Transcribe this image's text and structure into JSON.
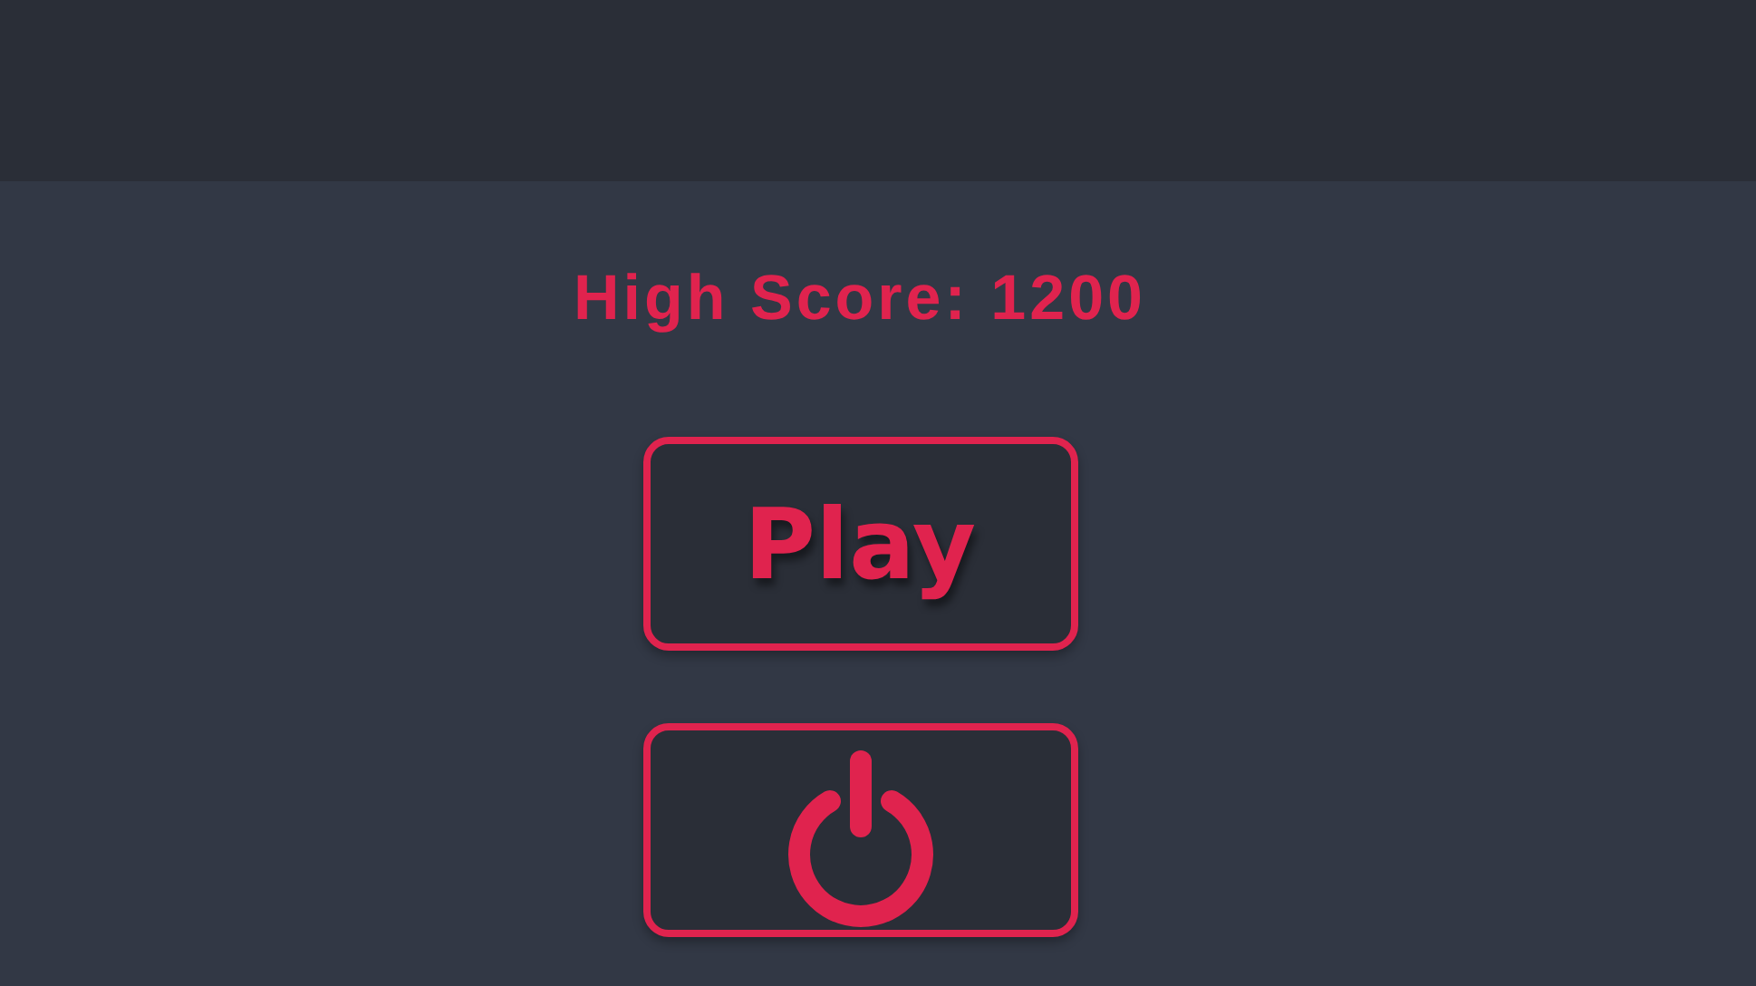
{
  "high_score": "High Score: 1200",
  "buttons": [
    {
      "kind": "text",
      "label": "Play"
    },
    {
      "kind": "power"
    }
  ]
}
